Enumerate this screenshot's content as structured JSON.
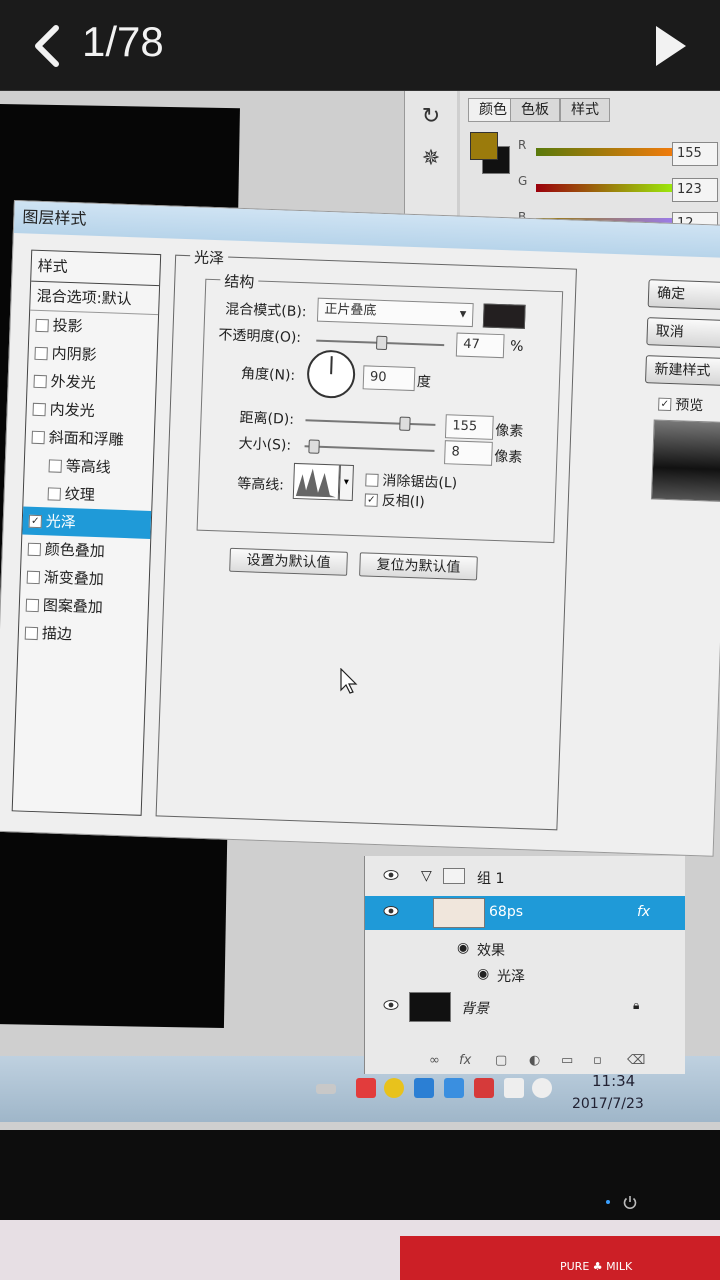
{
  "viewer": {
    "counter": "1/78"
  },
  "color_panel": {
    "tabs": [
      "颜色",
      "色板",
      "样式"
    ],
    "channels": [
      {
        "label": "R",
        "value": "155"
      },
      {
        "label": "G",
        "value": "123"
      },
      {
        "label": "B",
        "value": "12"
      }
    ],
    "foreground": "#9b7b0c",
    "background": "#111111"
  },
  "dialog": {
    "title": "图层样式",
    "style_list_header": "样式",
    "blend_default": "混合选项:默认",
    "styles": [
      {
        "label": "投影",
        "checked": false,
        "indent": false
      },
      {
        "label": "内阴影",
        "checked": false,
        "indent": false
      },
      {
        "label": "外发光",
        "checked": false,
        "indent": false
      },
      {
        "label": "内发光",
        "checked": false,
        "indent": false
      },
      {
        "label": "斜面和浮雕",
        "checked": false,
        "indent": false
      },
      {
        "label": "等高线",
        "checked": false,
        "indent": true
      },
      {
        "label": "纹理",
        "checked": false,
        "indent": true
      },
      {
        "label": "光泽",
        "checked": true,
        "indent": false,
        "selected": true
      },
      {
        "label": "颜色叠加",
        "checked": false,
        "indent": false
      },
      {
        "label": "渐变叠加",
        "checked": false,
        "indent": false
      },
      {
        "label": "图案叠加",
        "checked": false,
        "indent": false
      },
      {
        "label": "描边",
        "checked": false,
        "indent": false
      }
    ],
    "section_title": "光泽",
    "group_title": "结构",
    "blend_mode_label": "混合模式(B):",
    "blend_mode_value": "正片叠底",
    "opacity_label": "不透明度(O):",
    "opacity_value": "47",
    "opacity_unit": "%",
    "angle_label": "角度(N):",
    "angle_value": "90",
    "angle_unit": "度",
    "distance_label": "距离(D):",
    "distance_value": "155",
    "distance_unit": "像素",
    "size_label": "大小(S):",
    "size_value": "8",
    "size_unit": "像素",
    "contour_label": "等高线:",
    "antialias_label": "消除锯齿(L)",
    "invert_label": "反相(I)",
    "set_default": "设置为默认值",
    "reset_default": "复位为默认值",
    "ok_label": "确定",
    "cancel_label": "取消",
    "new_style_label": "新建样式",
    "preview_label": "预览"
  },
  "layers": {
    "group_name": "组 1",
    "layer_name": "68ps",
    "fx": "fx",
    "effects_label": "效果",
    "effect_item": "光泽",
    "background_name": "背景",
    "toolbar": [
      "∞",
      "fx"
    ]
  },
  "taskbar": {
    "time": "11:34",
    "date": "2017/7/23"
  },
  "photo_label": "PURE ♣ MILK"
}
